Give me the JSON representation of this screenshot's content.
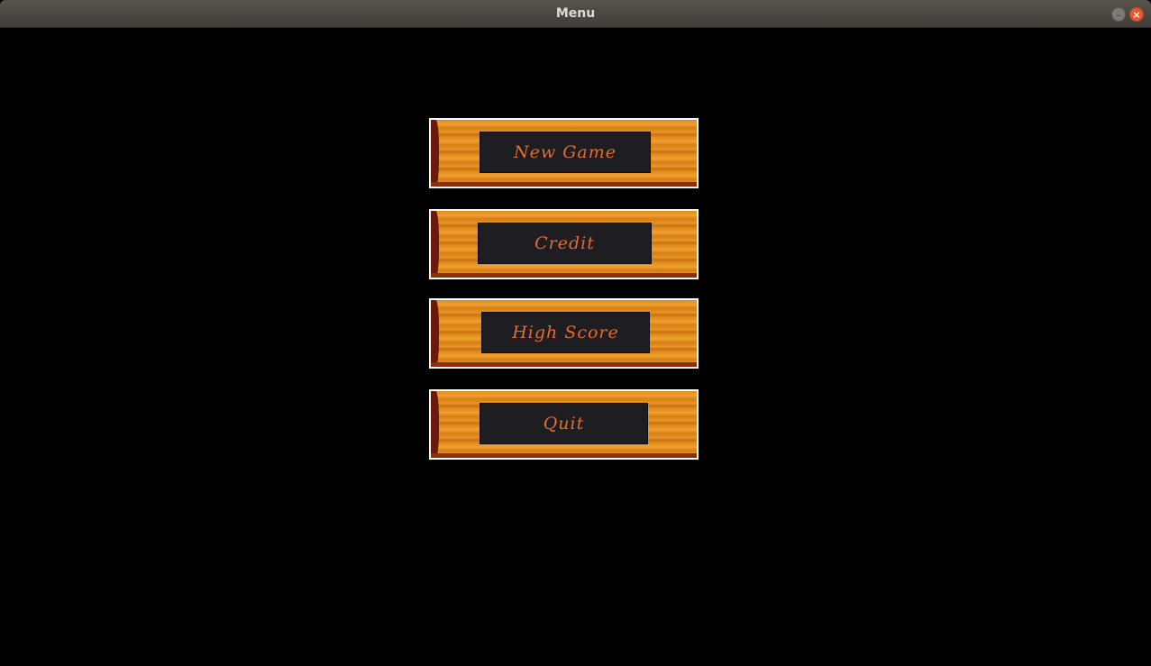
{
  "window": {
    "title": "Menu",
    "minimize_glyph": "–",
    "close_glyph": "×"
  },
  "menu": {
    "items": [
      {
        "label": "New Game"
      },
      {
        "label": "Credit"
      },
      {
        "label": "High Score"
      },
      {
        "label": "Quit"
      }
    ]
  },
  "colors": {
    "background": "#000000",
    "plank_wood": "#e08a1a",
    "panel": "#1d1d22",
    "label_text": "#e86a2c",
    "close_button": "#e9592f"
  }
}
